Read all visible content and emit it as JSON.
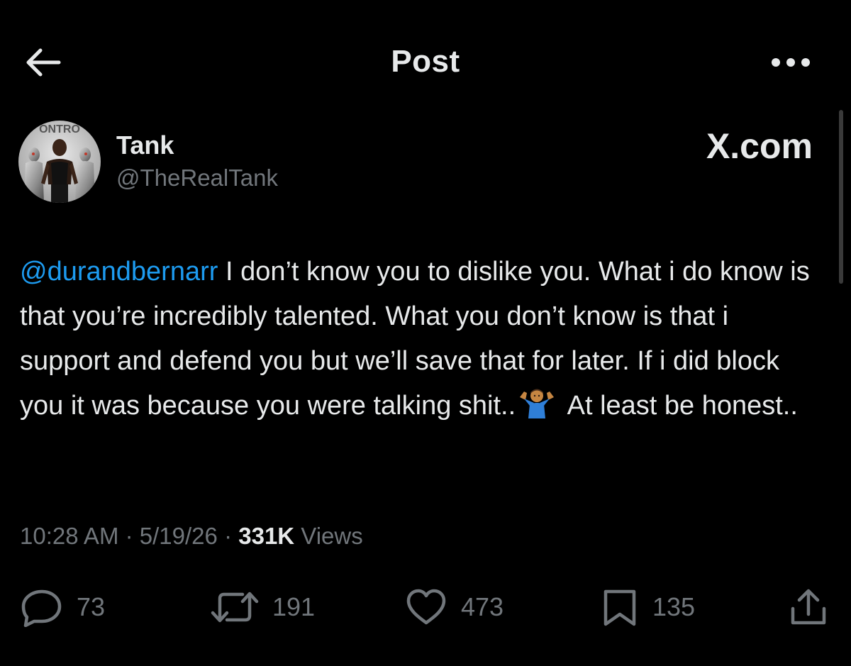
{
  "header": {
    "title": "Post",
    "back_icon": "arrow-left-icon",
    "more_icon": "more-horizontal-icon"
  },
  "author": {
    "display_name": "Tank",
    "handle": "@TheRealTank",
    "avatar_icon": "avatar-image",
    "avatar_text": "ONTRO"
  },
  "watermark": {
    "text": "X.com",
    "prefix": "X",
    "suffix": ".com"
  },
  "post": {
    "mention": "@durandbernarr",
    "text_part1": " I don’t know you to dislike you. What i do know is that you’re incredibly talented. What you don’t know is that i support and defend you but we’ll save that for later. If i did block you it was because you were talking shit..",
    "emoji": "person-shrugging-emoji",
    "text_part2": " At least be honest.."
  },
  "meta": {
    "time": "10:28 AM",
    "date": "5/19/26",
    "separator": "·",
    "views_count": "331K",
    "views_label": "Views"
  },
  "actions": {
    "replies": {
      "icon": "reply-icon",
      "count": "73"
    },
    "reposts": {
      "icon": "repost-icon",
      "count": "191"
    },
    "likes": {
      "icon": "heart-icon",
      "count": "473"
    },
    "bookmarks": {
      "icon": "bookmark-icon",
      "count": "135"
    },
    "share": {
      "icon": "share-icon"
    }
  },
  "colors": {
    "background": "#000000",
    "text": "#e7e9ea",
    "secondary": "#71767b",
    "link": "#1d9bf0"
  }
}
